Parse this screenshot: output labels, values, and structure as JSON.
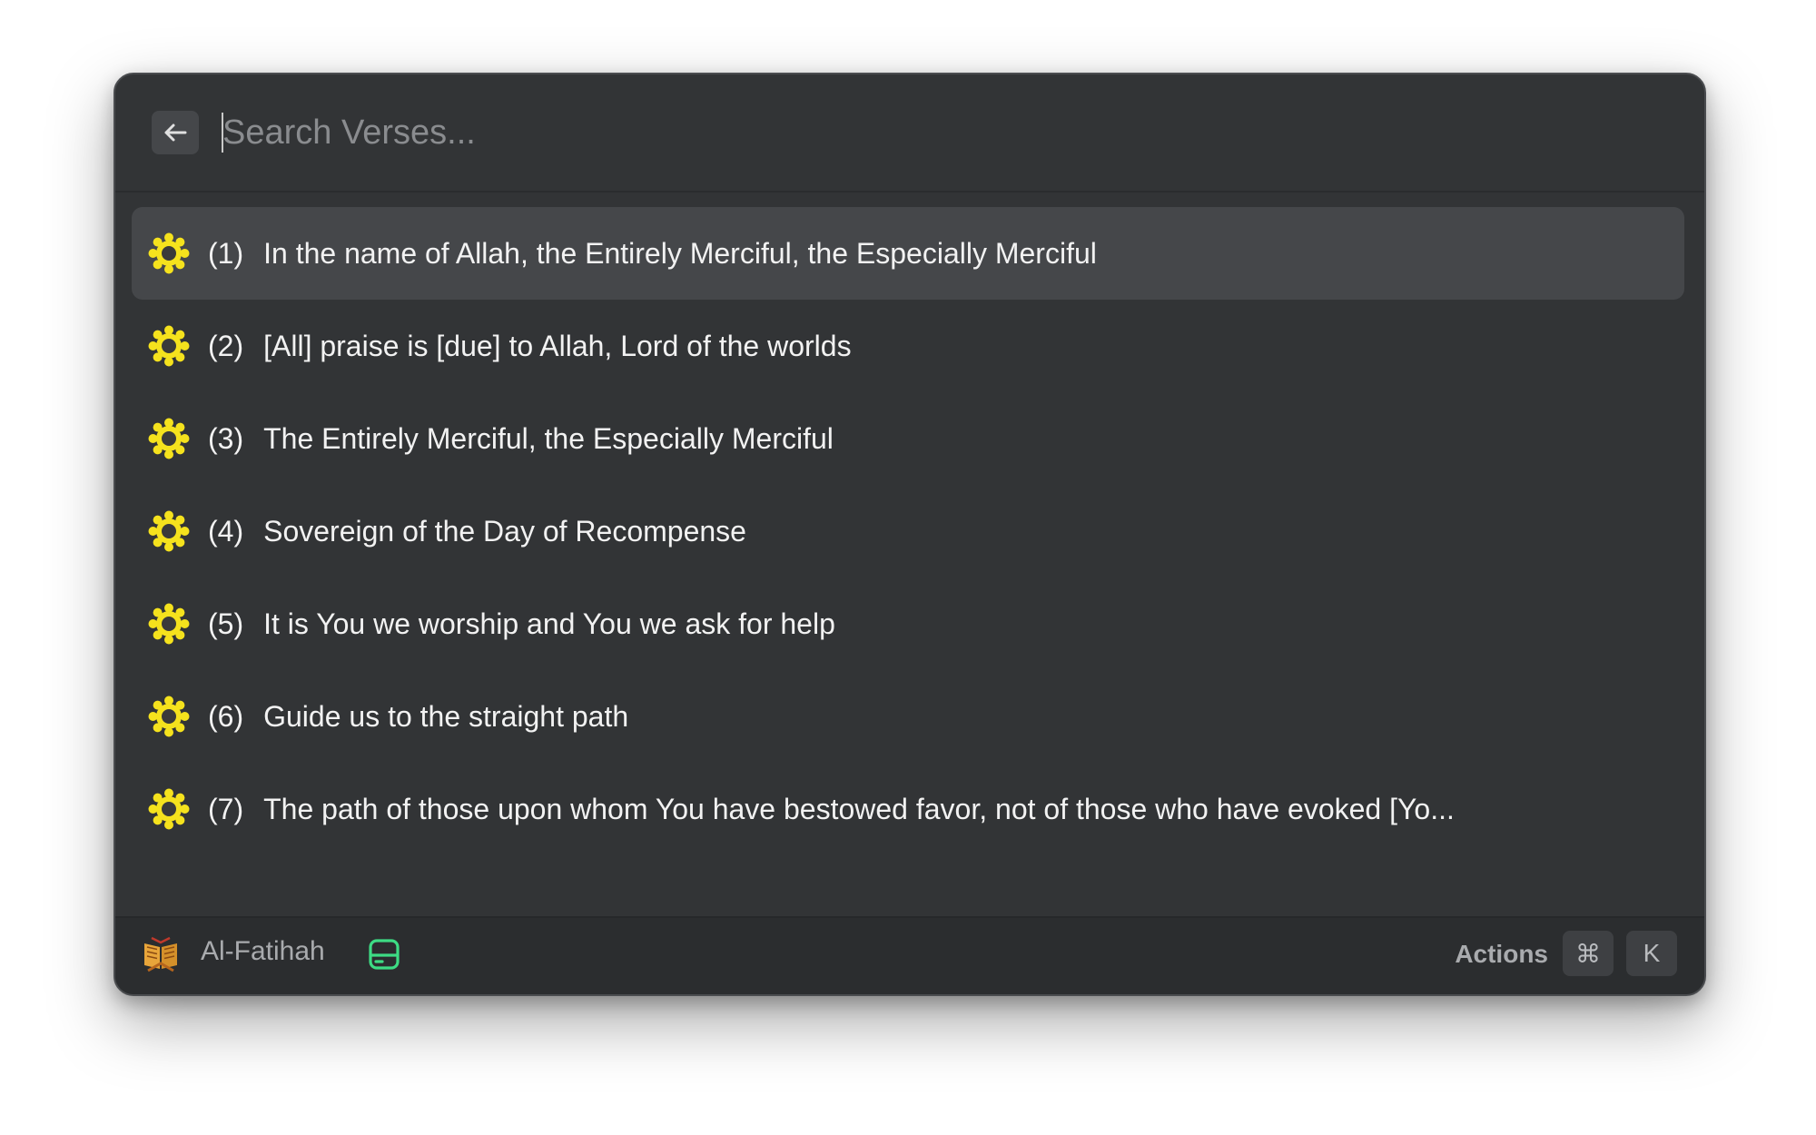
{
  "search": {
    "placeholder": "Search Verses..."
  },
  "verses": [
    {
      "number": "(1)",
      "text": "In the name of Allah, the Entirely Merciful, the Especially Merciful",
      "selected": true
    },
    {
      "number": "(2)",
      "text": "[All] praise is [due] to Allah, Lord of the worlds"
    },
    {
      "number": "(3)",
      "text": "The Entirely Merciful, the Especially Merciful"
    },
    {
      "number": "(4)",
      "text": "Sovereign of the Day of Recompense"
    },
    {
      "number": "(5)",
      "text": "It is You we worship and You we ask for help"
    },
    {
      "number": "(6)",
      "text": "Guide us to the straight path"
    },
    {
      "number": "(7)",
      "text": "The path of those upon whom You have bestowed favor, not of those who have evoked [Yo..."
    }
  ],
  "footer": {
    "surah_name": "Al-Fatihah",
    "actions_label": "Actions",
    "shortcut_modifier": "⌘",
    "shortcut_key": "K"
  },
  "icons": {
    "back": "arrow-left-icon",
    "verse": "verse-star-icon",
    "book": "quran-book-icon",
    "storage": "storage-drive-icon"
  },
  "colors": {
    "verse_icon": "#f5e21d",
    "storage_icon": "#3ddc84",
    "book_icon": "#e8a53a"
  }
}
